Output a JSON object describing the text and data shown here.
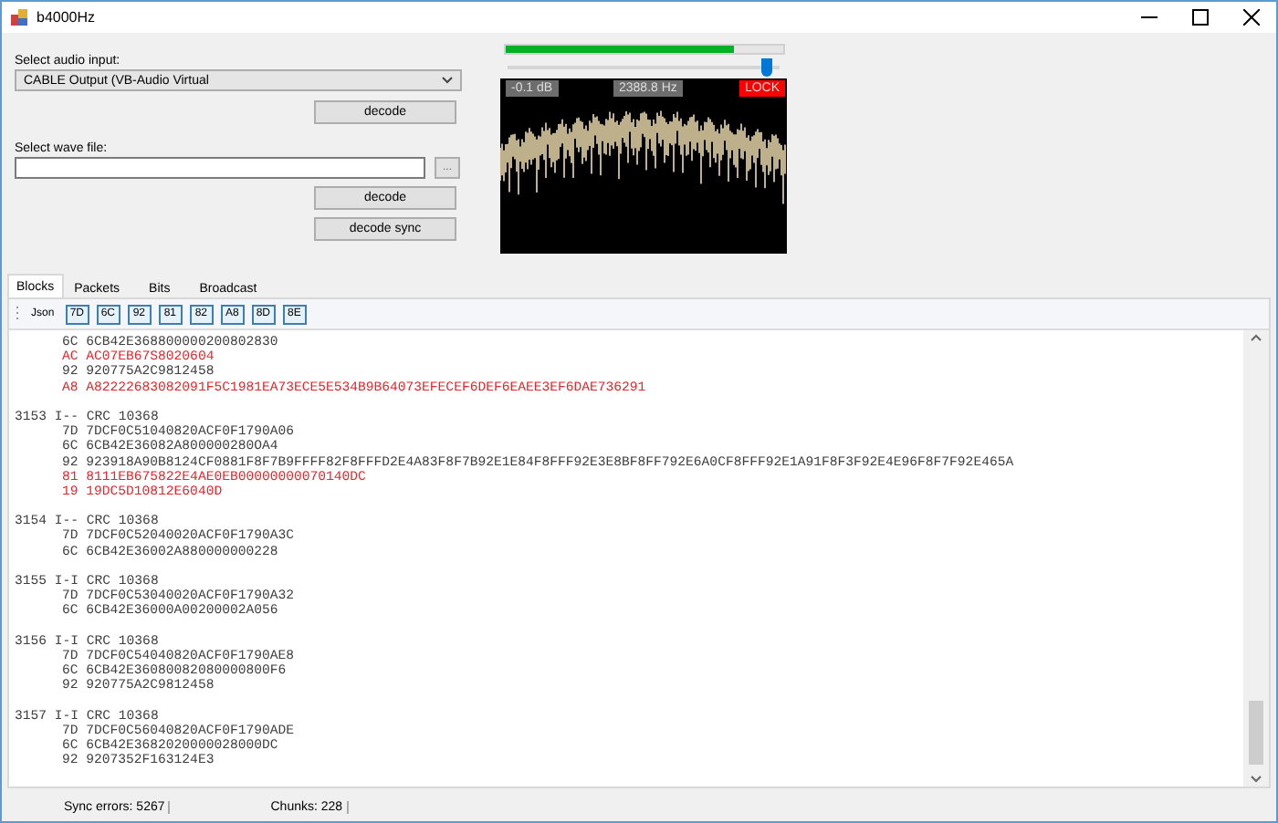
{
  "window": {
    "title": "b4000Hz"
  },
  "audio_input": {
    "label": "Select audio input:",
    "value": "CABLE Output (VB-Audio Virtual",
    "button": "decode"
  },
  "wave_file": {
    "label": "Select wave file:",
    "browse": "...",
    "buttons": [
      "decode",
      "decode sync"
    ]
  },
  "monitor": {
    "signal_meter": {
      "level": 0.82
    },
    "gain_slider": {
      "level": 0.95
    },
    "readings": [
      {
        "kind": "level",
        "text": "-0.1 dB"
      },
      {
        "kind": "frequency",
        "text": "2388.8 Hz"
      },
      {
        "kind": "lock",
        "text": "LOCK"
      }
    ]
  },
  "tabs": [
    {
      "label": "Blocks",
      "selected": true
    },
    {
      "label": "Packets",
      "selected": false
    },
    {
      "label": "Bits",
      "selected": false
    },
    {
      "label": "Broadcast",
      "selected": false
    }
  ],
  "toolbar": {
    "json_button": "Json",
    "filters": [
      "7D",
      "6C",
      "92",
      "81",
      "82",
      "A8",
      "8D",
      "8E"
    ]
  },
  "log": [
    {
      "kind": "data",
      "code": "6C",
      "value": "6CB42E368800000200802830",
      "flagged": false
    },
    {
      "kind": "data",
      "code": "AC",
      "value": "AC07EB67S8020604",
      "flagged": true
    },
    {
      "kind": "data",
      "code": "92",
      "value": "920775A2C9812458",
      "flagged": false
    },
    {
      "kind": "data",
      "code": "A8",
      "value": "A82222683082091F5C1981EA73ECE5E534B9B64073EFECEF6DEF6EAEE3EF6DAE736291",
      "flagged": true
    },
    {
      "kind": "blank"
    },
    {
      "kind": "header",
      "text": "3153 I-- CRC 10368"
    },
    {
      "kind": "data",
      "code": "7D",
      "value": "7DCF0C51040820ACF0F1790A06",
      "flagged": false
    },
    {
      "kind": "data",
      "code": "6C",
      "value": "6CB42E36082A800000280OA4",
      "flagged": false
    },
    {
      "kind": "data",
      "code": "92",
      "value": "923918A90B8124CF0881F8F7B9FFFF82F8FFFD2E4A83F8F7B92E1E84F8FFF92E3E8BF8FF792E6A0CF8FFF92E1A91F8F3F92E4E96F8F7F92E465A",
      "flagged": false
    },
    {
      "kind": "data",
      "code": "81",
      "value": "8111EB675822E4AE0EB00000000070140DC",
      "flagged": true
    },
    {
      "kind": "data",
      "code": "19",
      "value": "19DC5D10812E6040D",
      "flagged": true
    },
    {
      "kind": "blank"
    },
    {
      "kind": "header",
      "text": "3154 I-- CRC 10368"
    },
    {
      "kind": "data",
      "code": "7D",
      "value": "7DCF0C52040020ACF0F1790A3C",
      "flagged": false
    },
    {
      "kind": "data",
      "code": "6C",
      "value": "6CB42E36002A880000000228",
      "flagged": false
    },
    {
      "kind": "blank"
    },
    {
      "kind": "header",
      "text": "3155 I-I CRC 10368"
    },
    {
      "kind": "data",
      "code": "7D",
      "value": "7DCF0C53040020ACF0F1790A32",
      "flagged": false
    },
    {
      "kind": "data",
      "code": "6C",
      "value": "6CB42E36000A00200002A056",
      "flagged": false
    },
    {
      "kind": "blank"
    },
    {
      "kind": "header",
      "text": "3156 I-I CRC 10368"
    },
    {
      "kind": "data",
      "code": "7D",
      "value": "7DCF0C54040820ACF0F1790AE8",
      "flagged": false
    },
    {
      "kind": "data",
      "code": "6C",
      "value": "6CB42E36080082080000800F6",
      "flagged": false
    },
    {
      "kind": "data",
      "code": "92",
      "value": "920775A2C9812458",
      "flagged": false
    },
    {
      "kind": "blank"
    },
    {
      "kind": "header",
      "text": "3157 I-I CRC 10368"
    },
    {
      "kind": "data",
      "code": "7D",
      "value": "7DCF0C56040820ACF0F1790ADE",
      "flagged": false
    },
    {
      "kind": "data",
      "code": "6C",
      "value": "6CB42E3682020000028000DC",
      "flagged": false
    },
    {
      "kind": "data",
      "code": "92",
      "value": "9207352F163124E3",
      "flagged": false
    }
  ],
  "status_bar": [
    {
      "text": "Sync errors: 5267"
    },
    {
      "text": "Chunks: 228"
    }
  ]
}
